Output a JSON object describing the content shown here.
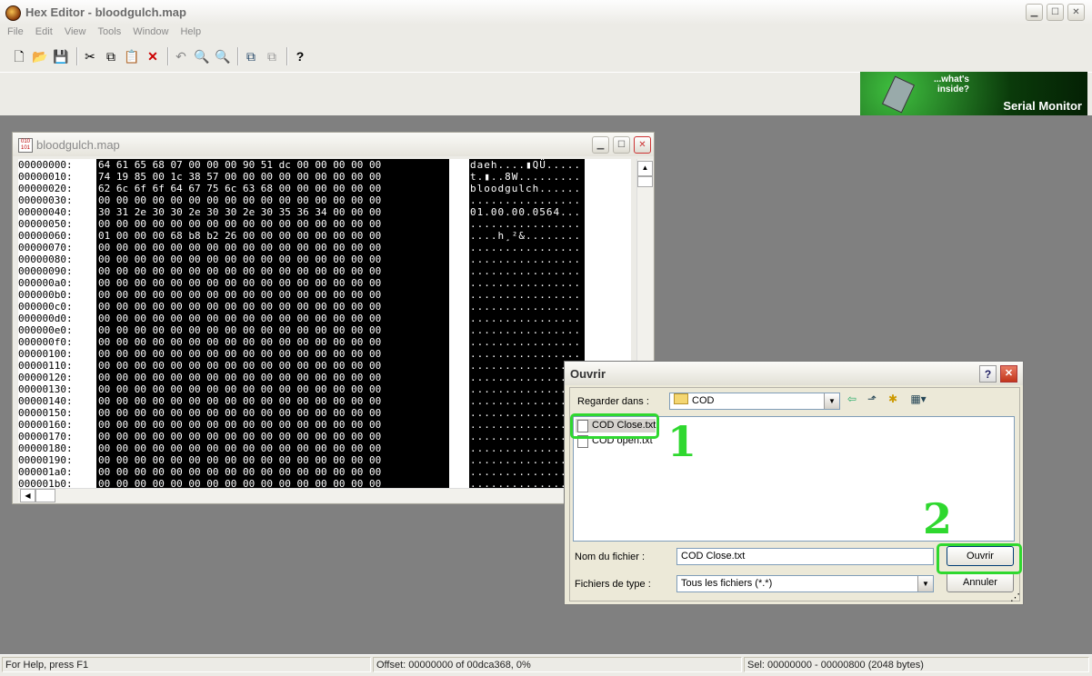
{
  "app": {
    "title": "Hex Editor - bloodgulch.map",
    "menu": [
      "File",
      "Edit",
      "View",
      "Tools",
      "Window",
      "Help"
    ],
    "toolbar_icons": [
      "new-file-icon",
      "open-folder-icon",
      "save-icon",
      "cut-icon",
      "copy-icon",
      "paste-icon",
      "delete-icon",
      "undo-icon",
      "find-icon",
      "replace-icon",
      "file-compare-icon",
      "file-compare-disabled-icon",
      "help-icon"
    ],
    "banner": {
      "tagline": "...what's inside?",
      "product": "Serial Monitor"
    }
  },
  "child_window": {
    "title": "bloodgulch.map",
    "offsets": [
      "00000000:",
      "00000010:",
      "00000020:",
      "00000030:",
      "00000040:",
      "00000050:",
      "00000060:",
      "00000070:",
      "00000080:",
      "00000090:",
      "000000a0:",
      "000000b0:",
      "000000c0:",
      "000000d0:",
      "000000e0:",
      "000000f0:",
      "00000100:",
      "00000110:",
      "00000120:",
      "00000130:",
      "00000140:",
      "00000150:",
      "00000160:",
      "00000170:",
      "00000180:",
      "00000190:",
      "000001a0:",
      "000001b0:"
    ],
    "hex_rows": [
      "64 61 65 68 07 00 00 00 90 51 dc 00 00 00 00 00",
      "74 19 85 00 1c 38 57 00 00 00 00 00 00 00 00 00",
      "62 6c 6f 6f 64 67 75 6c 63 68 00 00 00 00 00 00",
      "00 00 00 00 00 00 00 00 00 00 00 00 00 00 00 00",
      "30 31 2e 30 30 2e 30 30 2e 30 35 36 34 00 00 00",
      "00 00 00 00 00 00 00 00 00 00 00 00 00 00 00 00",
      "01 00 00 00 68 b8 b2 26 00 00 00 00 00 00 00 00",
      "00 00 00 00 00 00 00 00 00 00 00 00 00 00 00 00",
      "00 00 00 00 00 00 00 00 00 00 00 00 00 00 00 00",
      "00 00 00 00 00 00 00 00 00 00 00 00 00 00 00 00",
      "00 00 00 00 00 00 00 00 00 00 00 00 00 00 00 00",
      "00 00 00 00 00 00 00 00 00 00 00 00 00 00 00 00",
      "00 00 00 00 00 00 00 00 00 00 00 00 00 00 00 00",
      "00 00 00 00 00 00 00 00 00 00 00 00 00 00 00 00",
      "00 00 00 00 00 00 00 00 00 00 00 00 00 00 00 00",
      "00 00 00 00 00 00 00 00 00 00 00 00 00 00 00 00",
      "00 00 00 00 00 00 00 00 00 00 00 00 00 00 00 00",
      "00 00 00 00 00 00 00 00 00 00 00 00 00 00 00 00",
      "00 00 00 00 00 00 00 00 00 00 00 00 00 00 00 00",
      "00 00 00 00 00 00 00 00 00 00 00 00 00 00 00 00",
      "00 00 00 00 00 00 00 00 00 00 00 00 00 00 00 00",
      "00 00 00 00 00 00 00 00 00 00 00 00 00 00 00 00",
      "00 00 00 00 00 00 00 00 00 00 00 00 00 00 00 00",
      "00 00 00 00 00 00 00 00 00 00 00 00 00 00 00 00",
      "00 00 00 00 00 00 00 00 00 00 00 00 00 00 00 00",
      "00 00 00 00 00 00 00 00 00 00 00 00 00 00 00 00",
      "00 00 00 00 00 00 00 00 00 00 00 00 00 00 00 00",
      "00 00 00 00 00 00 00 00 00 00 00 00 00 00 00 00"
    ],
    "ascii_rows": [
      "daeh....▮QÜ.....",
      "t.▮..8W.........",
      "bloodgulch......",
      "................",
      "01.00.00.0564...",
      "................",
      "....h¸²&........",
      "................",
      "................",
      "................",
      "................",
      "................",
      "................",
      "................",
      "................",
      "................",
      "................",
      "................",
      "................",
      "................",
      "................",
      "................",
      "................",
      "................",
      "................",
      "................",
      "................",
      "................"
    ]
  },
  "dialog": {
    "title": "Ouvrir",
    "look_in_label": "Regarder dans :",
    "look_in_value": "COD",
    "files": [
      "COD Close.txt",
      "COD open.txt"
    ],
    "filename_label": "Nom du fichier :",
    "filename_value": "COD Close.txt",
    "filetype_label": "Fichiers de type :",
    "filetype_value": "Tous les fichiers (*.*)",
    "open_button": "Ouvrir",
    "cancel_button": "Annuler",
    "annotations": [
      "1",
      "2"
    ],
    "annotation_color": "#2fd82f"
  },
  "status": {
    "help": "For Help, press F1",
    "offset": "Offset: 00000000 of 00dca368, 0%",
    "selection": "Sel: 00000000 - 00000800 (2048 bytes)"
  }
}
